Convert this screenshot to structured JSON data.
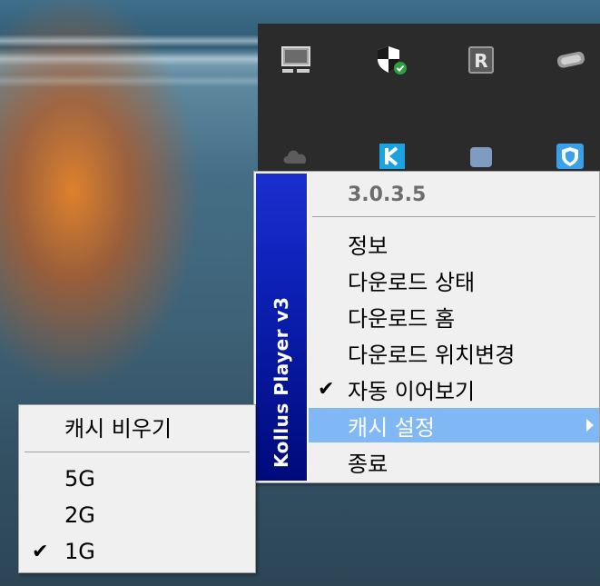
{
  "menu": {
    "sidebar_title": "Kollus Player v3",
    "version": "3.0.3.5",
    "items": [
      {
        "label": "정보",
        "checked": false
      },
      {
        "label": "다운로드 상태",
        "checked": false
      },
      {
        "label": "다운로드 홈",
        "checked": false
      },
      {
        "label": "다운로드 위치변경",
        "checked": false
      },
      {
        "label": "자동 이어보기",
        "checked": true
      },
      {
        "label": "캐시 설정",
        "checked": false,
        "highlighted": true,
        "has_submenu": true
      },
      {
        "label": "종료",
        "checked": false
      }
    ],
    "check_glyph": "✔"
  },
  "submenu": {
    "items": [
      {
        "label": "캐시 비우기",
        "checked": false
      },
      {
        "label": "5G",
        "checked": false
      },
      {
        "label": "2G",
        "checked": false
      },
      {
        "label": "1G",
        "checked": true
      }
    ],
    "check_glyph": "✔"
  },
  "tray": {
    "icons": [
      "monitor-icon",
      "security-shield-icon",
      "r-app-icon",
      "usb-drive-icon",
      "cloud-icon",
      "kollus-k-icon",
      "app-blue-icon",
      "shield-blue-icon"
    ],
    "r_letter": "R"
  },
  "colors": {
    "sidebar": "#0b1fb3",
    "highlight": "#7fb8f5",
    "menu_bg": "#f0f0f0",
    "tray_bg": "#2b2b2b"
  }
}
